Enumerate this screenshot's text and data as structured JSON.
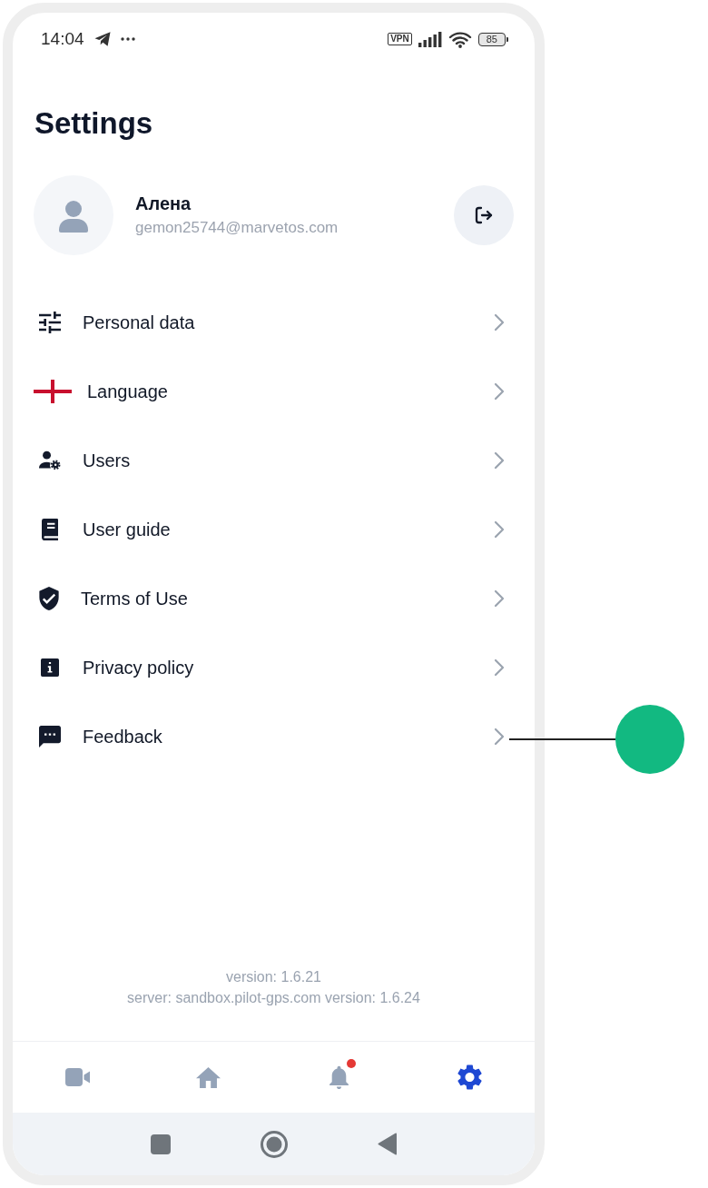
{
  "status_bar": {
    "time": "14:04",
    "vpn": "VPN",
    "battery": "85"
  },
  "header": {
    "title": "Settings"
  },
  "profile": {
    "name": "Алена",
    "email": "gemon25744@marvetos.com"
  },
  "menu": [
    {
      "label": "Personal data",
      "callout": false
    },
    {
      "label": "Language",
      "callout": false
    },
    {
      "label": "Users",
      "callout": false
    },
    {
      "label": "User guide",
      "callout": false
    },
    {
      "label": "Terms of Use",
      "callout": false
    },
    {
      "label": "Privacy policy",
      "callout": false
    },
    {
      "label": "Feedback",
      "callout": true
    }
  ],
  "footer": {
    "app_version": "version: 1.6.21",
    "server_version": "server: sandbox.pilot-gps.com version: 1.6.24"
  },
  "bottom_nav": [
    {
      "selected": false,
      "unread": false
    },
    {
      "selected": false,
      "unread": false
    },
    {
      "selected": false,
      "unread": true
    },
    {
      "selected": true,
      "unread": false
    }
  ]
}
